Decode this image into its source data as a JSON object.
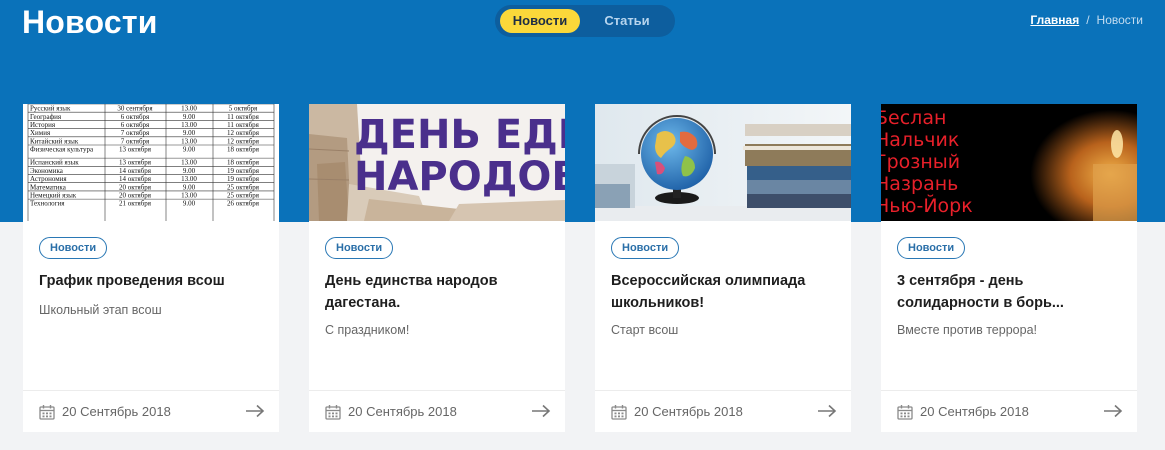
{
  "header": {
    "title": "Новости",
    "tabs": [
      {
        "label": "Новости",
        "active": true
      },
      {
        "label": "Статьи",
        "active": false
      }
    ],
    "breadcrumb": {
      "home": "Главная",
      "separator": "/",
      "current": "Новости"
    }
  },
  "colors": {
    "hero": "#0a72ba",
    "active_tab": "#fbd83a",
    "badge_border": "#2a78b5"
  },
  "cards": [
    {
      "badge": "Новости",
      "title": "График проведения всош",
      "excerpt": "Школьный этап всош",
      "date": "20 Сентябрь 2018",
      "thumb": {
        "rows": [
          [
            "Русский язык",
            "30 сентября",
            "13.00",
            "5 октября"
          ],
          [
            "География",
            "6 октября",
            "9.00",
            "11 октября"
          ],
          [
            "История",
            "6 октября",
            "13.00",
            "11 октября"
          ],
          [
            "Химия",
            "7 октября",
            "9.00",
            "12 октября"
          ],
          [
            "Китайский язык",
            "7 октября",
            "13.00",
            "12 октября"
          ],
          [
            "Физическая культура",
            "13 октября",
            "9.00",
            "18 октября"
          ],
          [
            "Испанский язык",
            "13 октября",
            "13.00",
            "18 октября"
          ],
          [
            "Экономика",
            "14 октября",
            "9.00",
            "19 октября"
          ],
          [
            "Астрономия",
            "14 октября",
            "13.00",
            "19 октября"
          ],
          [
            "Математика",
            "20 октября",
            "9.00",
            "25 октября"
          ],
          [
            "Немецкий язык",
            "20 октября",
            "13.00",
            "25 октября"
          ],
          [
            "Технология",
            "21 октября",
            "9.00",
            "26 октября"
          ]
        ]
      }
    },
    {
      "badge": "Новости",
      "title": "День единства народов дагестана.",
      "excerpt": "С праздником!",
      "date": "20 Сентябрь 2018",
      "thumb": {
        "line1": "ДЕНЬ ЕДИН",
        "line2": "НАРОДОВ Д"
      }
    },
    {
      "badge": "Новости",
      "title": "Всероссийская олимпиада школьников!",
      "excerpt": "Старт всош",
      "date": "20 Сентябрь 2018",
      "thumb": {
        "icon": "globe-books"
      }
    },
    {
      "badge": "Новости",
      "title": "3 сентября - день солидарности в борь...",
      "excerpt": "Вместе против террора!",
      "date": "20 Сентябрь 2018",
      "thumb": {
        "lines": [
          "Беслан",
          "Нальчик",
          "Грозный",
          "Назрань",
          "Нью-Йорк"
        ]
      }
    }
  ]
}
